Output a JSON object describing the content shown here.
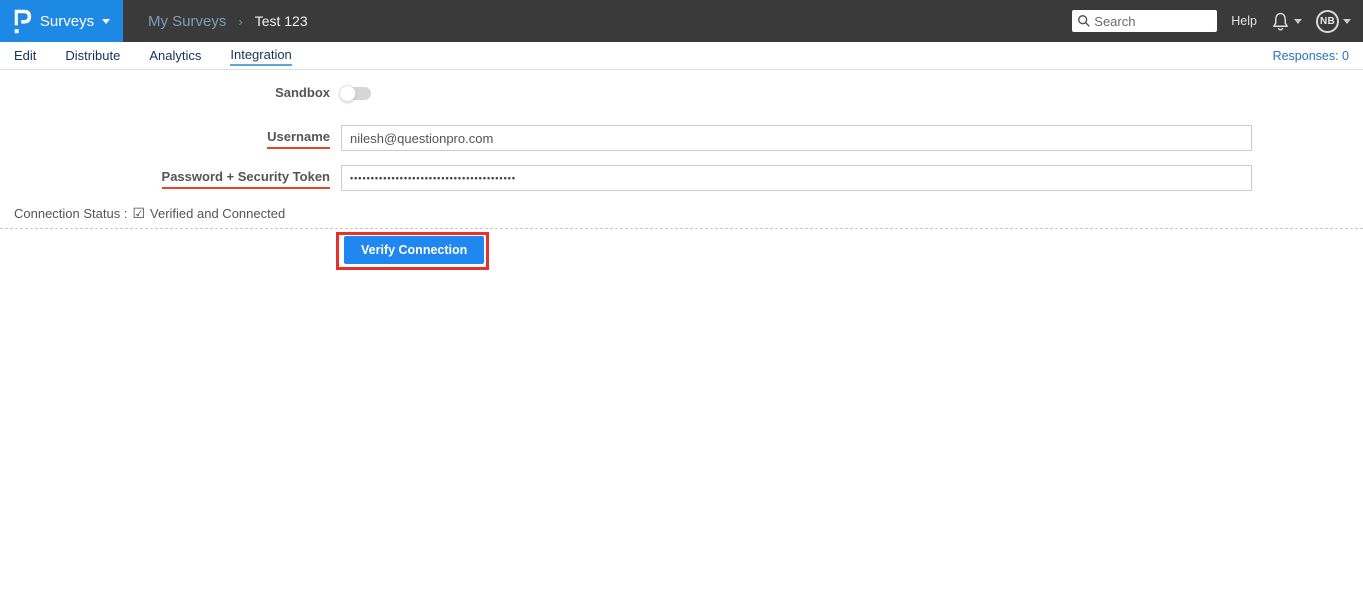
{
  "topnav": {
    "brand_label": "Surveys",
    "breadcrumb_parent": "My Surveys",
    "breadcrumb_separator": "›",
    "breadcrumb_current": "Test 123",
    "search_placeholder": "Search",
    "help_label": "Help",
    "avatar_initials": "NB"
  },
  "tabs": {
    "items": [
      {
        "label": "Edit"
      },
      {
        "label": "Distribute"
      },
      {
        "label": "Analytics"
      },
      {
        "label": "Integration"
      }
    ],
    "active_tab": "Integration",
    "responses_label": "Responses: 0"
  },
  "form": {
    "sandbox_label": "Sandbox",
    "sandbox_state": "off",
    "username_label": "Username",
    "username_value": "nilesh@questionpro.com",
    "password_label": "Password + Security Token",
    "password_masked_value": "••••••••••••••••••••••••••••••••••••••••",
    "connection_status_label": "Connection Status :",
    "connection_status_icon": "☑",
    "connection_status_value": "Verified and Connected",
    "verify_button_label": "Verify Connection"
  },
  "colors": {
    "brand_blue": "#1e88e5",
    "topnav_bg": "#3a3a3a",
    "tab_text": "#16325c",
    "tab_active_underline": "#5aa7e0",
    "responses_blue": "#2574c7",
    "label_underline_red": "#e8442d",
    "button_blue": "#2086f0",
    "annotation_red": "#e8312a"
  }
}
